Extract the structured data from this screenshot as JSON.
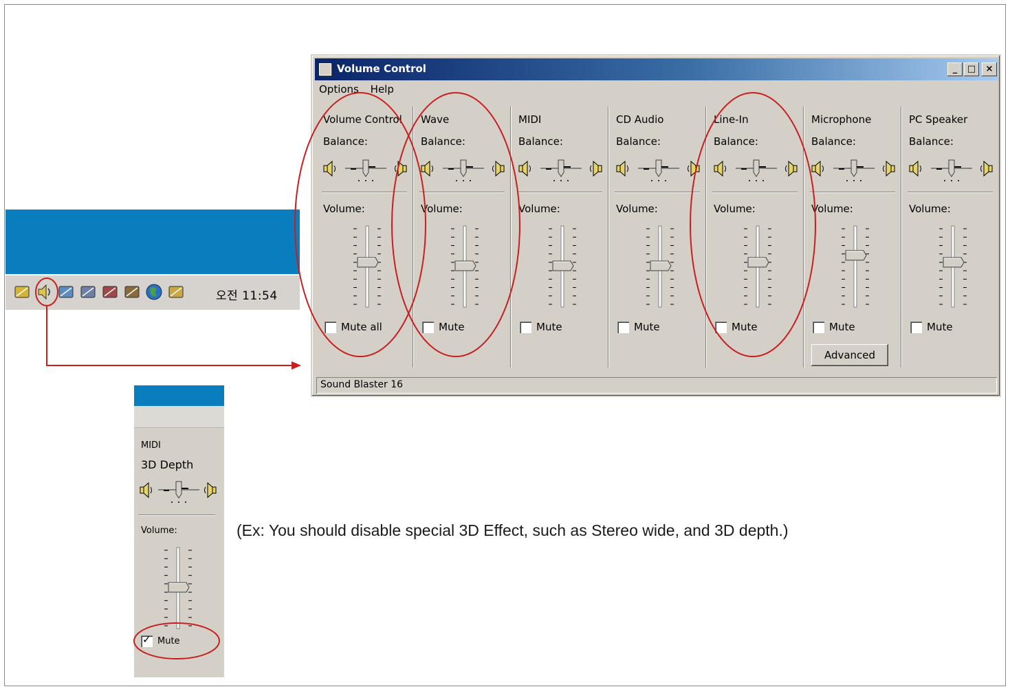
{
  "taskbar": {
    "clock": "오전 11:54",
    "icons": [
      "pencil-icon",
      "speaker-icon",
      "network-icon",
      "printer-icon",
      "user-icon",
      "pen-icon",
      "globe-icon",
      "folder-icon"
    ]
  },
  "volume_window": {
    "title": "Volume Control",
    "buttons": {
      "minimize": "_",
      "maximize": "□",
      "close": "×"
    },
    "menu": [
      "Options",
      "Help"
    ],
    "balance_label": "Balance:",
    "volume_label": "Volume:",
    "status": "Sound Blaster 16",
    "channels": [
      {
        "name": "Volume Control",
        "mute_label": "Mute all",
        "muted": false,
        "volume": 0.55,
        "balance": 0.5
      },
      {
        "name": "Wave",
        "mute_label": "Mute",
        "muted": false,
        "volume": 0.5,
        "balance": 0.5
      },
      {
        "name": "MIDI",
        "mute_label": "Mute",
        "muted": false,
        "volume": 0.5,
        "balance": 0.5
      },
      {
        "name": "CD Audio",
        "mute_label": "Mute",
        "muted": false,
        "volume": 0.5,
        "balance": 0.5
      },
      {
        "name": "Line-In",
        "mute_label": "Mute",
        "muted": false,
        "volume": 0.55,
        "balance": 0.5
      },
      {
        "name": "Microphone",
        "mute_label": "Mute",
        "muted": false,
        "volume": 0.65,
        "balance": 0.5,
        "advanced_label": "Advanced"
      },
      {
        "name": "PC Speaker",
        "mute_label": "Mute",
        "muted": false,
        "volume": 0.55,
        "balance": 0.5
      }
    ]
  },
  "midi_detail": {
    "title": "MIDI",
    "depth_label": "3D Depth",
    "volume_label": "Volume:",
    "mute_label": "Mute",
    "muted": true,
    "volume": 0.5
  },
  "note": "(Ex: You should disable special 3D Effect, such as Stereo wide, and 3D depth.)",
  "colors": {
    "annotation": "#c81e1e",
    "taskbar_blue": "#0a7dbf",
    "dialog_gray": "#d4d0c8"
  }
}
